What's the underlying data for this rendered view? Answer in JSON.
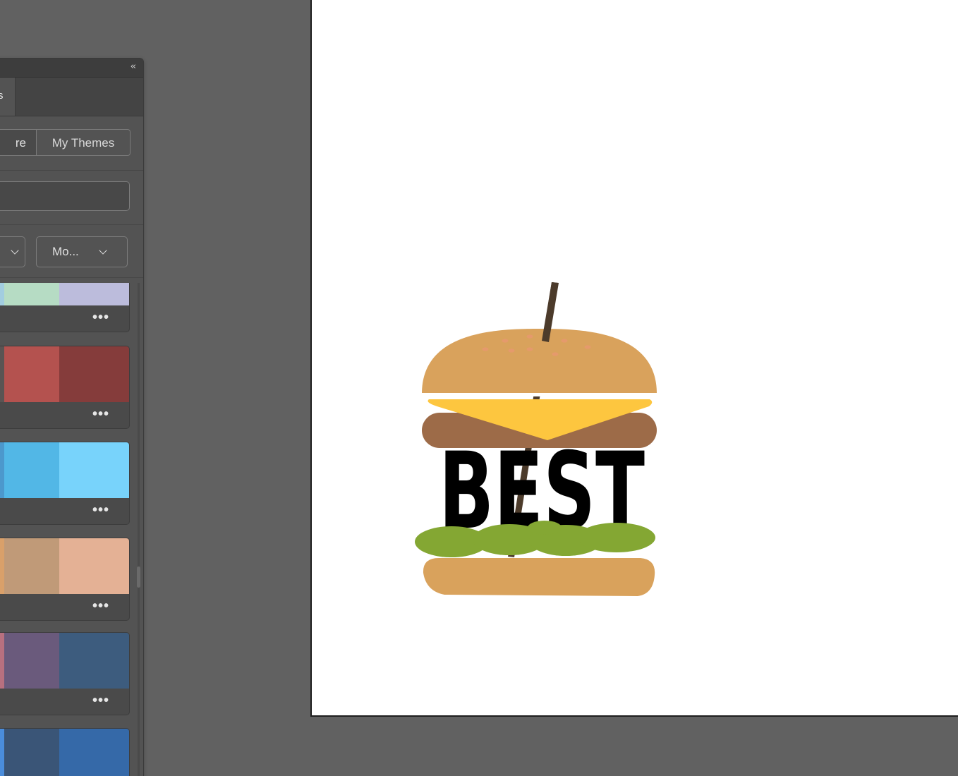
{
  "panel": {
    "collapse_icon": "‹‹",
    "tab_label": "s",
    "segmented": {
      "left_label": "re",
      "right_label": "My Themes"
    },
    "search": {
      "value": ""
    },
    "filters": {
      "first_label": "",
      "second_label": "Mo..."
    },
    "card_more_label": "•••",
    "themes": [
      {
        "colors": [
          "#a2cde0",
          "#b6dcc4",
          "#bcbcdc"
        ]
      },
      {
        "colors": [
          "#5a5453",
          "#b4524f",
          "#853c3b"
        ]
      },
      {
        "colors": [
          "#4c98cc",
          "#52b7e6",
          "#78d3fb"
        ]
      },
      {
        "colors": [
          "#d9a06a",
          "#c09a78",
          "#e4b195"
        ]
      },
      {
        "colors": [
          "#b8707f",
          "#6a5a7c",
          "#3d5c7e"
        ]
      },
      {
        "colors": [
          "#4a8ddc",
          "#3a5577",
          "#3569a8"
        ]
      }
    ]
  },
  "artwork": {
    "headline": "BEST",
    "colors": {
      "bun": "#d9a25c",
      "seed": "#e59a6c",
      "cheese": "#fdc63f",
      "patty": "#9d6b48",
      "lettuce": "#84a733",
      "stick": "#4c3b2b",
      "text": "#000000"
    }
  }
}
